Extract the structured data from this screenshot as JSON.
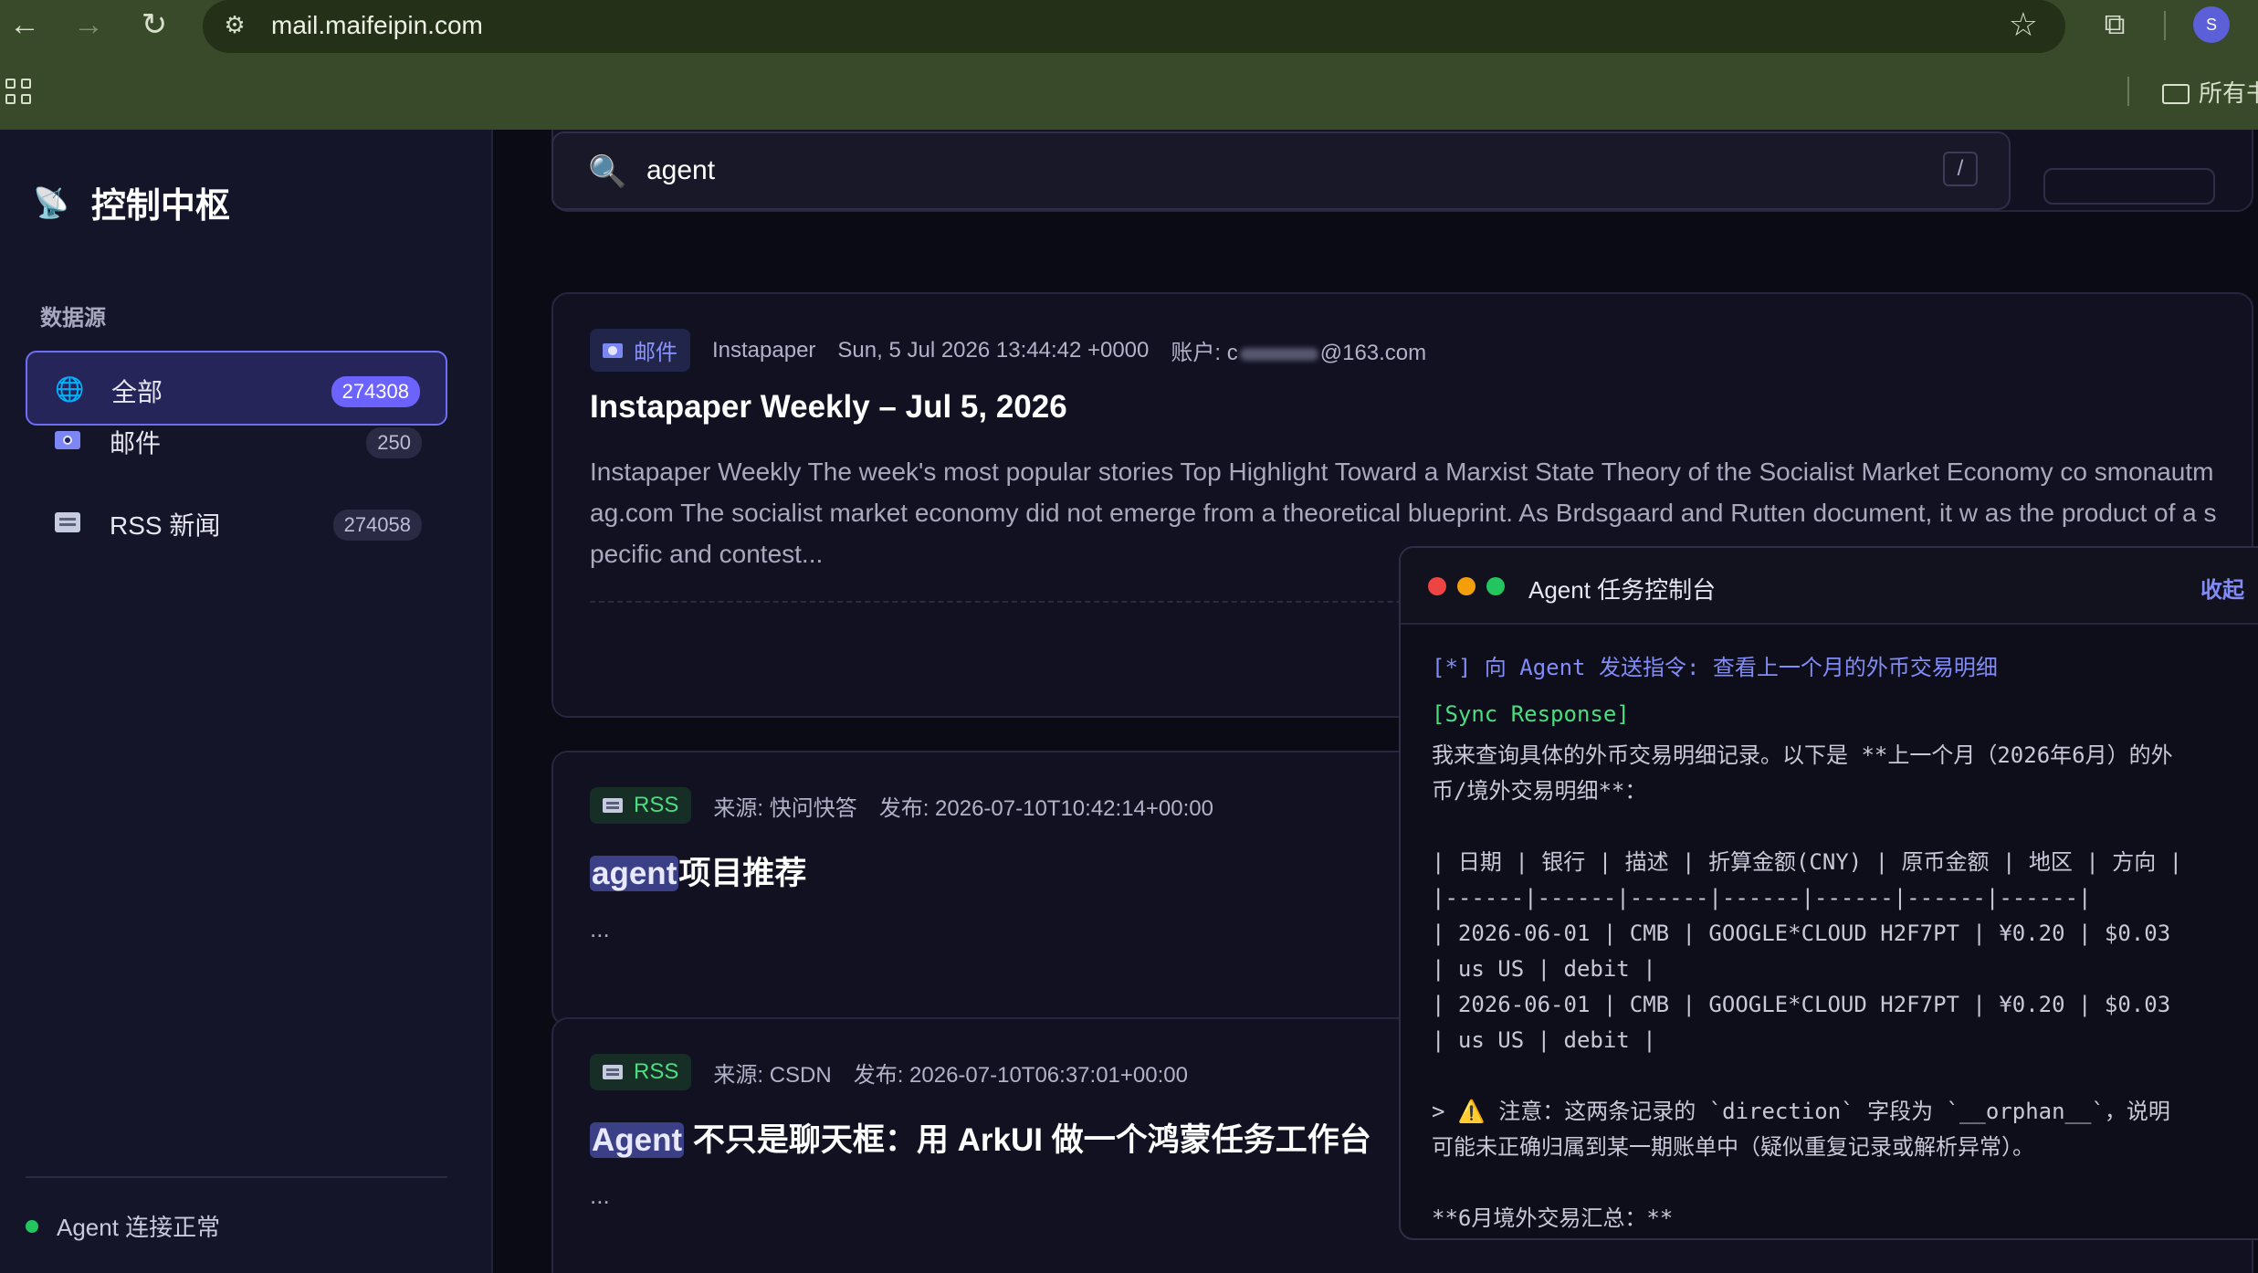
{
  "browser": {
    "url": "mail.maifeipin.com",
    "profile_initial": "S",
    "bookmark_folder": "所有书签"
  },
  "sidebar": {
    "title": "控制中枢",
    "section_label": "数据源",
    "items": [
      {
        "label": "全部",
        "count": "274308",
        "icon": "globe-icon"
      },
      {
        "label": "邮件",
        "count": "250",
        "icon": "mail-icon"
      },
      {
        "label": "RSS 新闻",
        "count": "274058",
        "icon": "newspaper-icon"
      }
    ],
    "status_text": "Agent 连接正常",
    "status_color": "#22c55e"
  },
  "search": {
    "query": "agent",
    "shortcut": "/"
  },
  "results": [
    {
      "type_label": "邮件",
      "source": "Instapaper",
      "date": "Sun, 5 Jul 2026 13:44:42 +0000",
      "account_label": "账户: c",
      "account_suffix": "@163.com",
      "title": "Instapaper Weekly – Jul 5, 2026",
      "excerpt": "Instapaper Weekly The week's most popular stories Top Highlight Toward a Marxist State Theory of the Socialist Market Economy co smonautmag.com The socialist market economy did not emerge from a theoretical blueprint. As Brdsgaard and Rutten document, it w as the product of a specific and contest..."
    },
    {
      "type_label": "RSS",
      "source": "来源: 快问快答",
      "date": "发布: 2026-07-10T10:42:14+00:00",
      "title_highlight": "agent",
      "title_rest": "项目推荐",
      "excerpt": "..."
    },
    {
      "type_label": "RSS",
      "source": "来源: CSDN",
      "date": "发布: 2026-07-10T06:37:01+00:00",
      "title_highlight": "Agent",
      "title_rest": " 不只是聊天框：用 ArkUI 做一个鸿蒙任务工作台",
      "excerpt": "..."
    }
  ],
  "console": {
    "title": "Agent 任务控制台",
    "collapse_label": "收起",
    "traffic_colors": [
      "#ef4444",
      "#f59e0b",
      "#22c55e"
    ],
    "command_line": "[*] 向 Agent 发送指令: 查看上一个月的外币交易明细",
    "sync_line": "[Sync Response]",
    "lines": [
      "我来查询具体的外币交易明细记录。以下是 **上一个月（2026年6月）的外",
      "币/境外交易明细**：",
      "",
      "| 日期 | 银行 | 描述 | 折算金额(CNY) | 原币金额 | 地区 | 方向 |",
      "|------|------|------|------|------|------|------|",
      "| 2026-06-01 | CMB | GOOGLE*CLOUD H2F7PT | ¥0.20 | $0.03",
      "| us US | debit |",
      "| 2026-06-01 | CMB | GOOGLE*CLOUD H2F7PT | ¥0.20 | $0.03",
      "| us US | debit |",
      "",
      "> ⚠️ 注意：这两条记录的 `direction` 字段为 `__orphan__`，说明",
      "可能未正确归属到某一期账单中（疑似重复记录或解析异常）。",
      "",
      "**6月境外交易汇总：**"
    ]
  },
  "colors": {
    "accent": "#6c63ff",
    "mail_tag": "#8a93ff",
    "rss_tag": "#4ade80",
    "chrome_bg": "#394a2a"
  }
}
